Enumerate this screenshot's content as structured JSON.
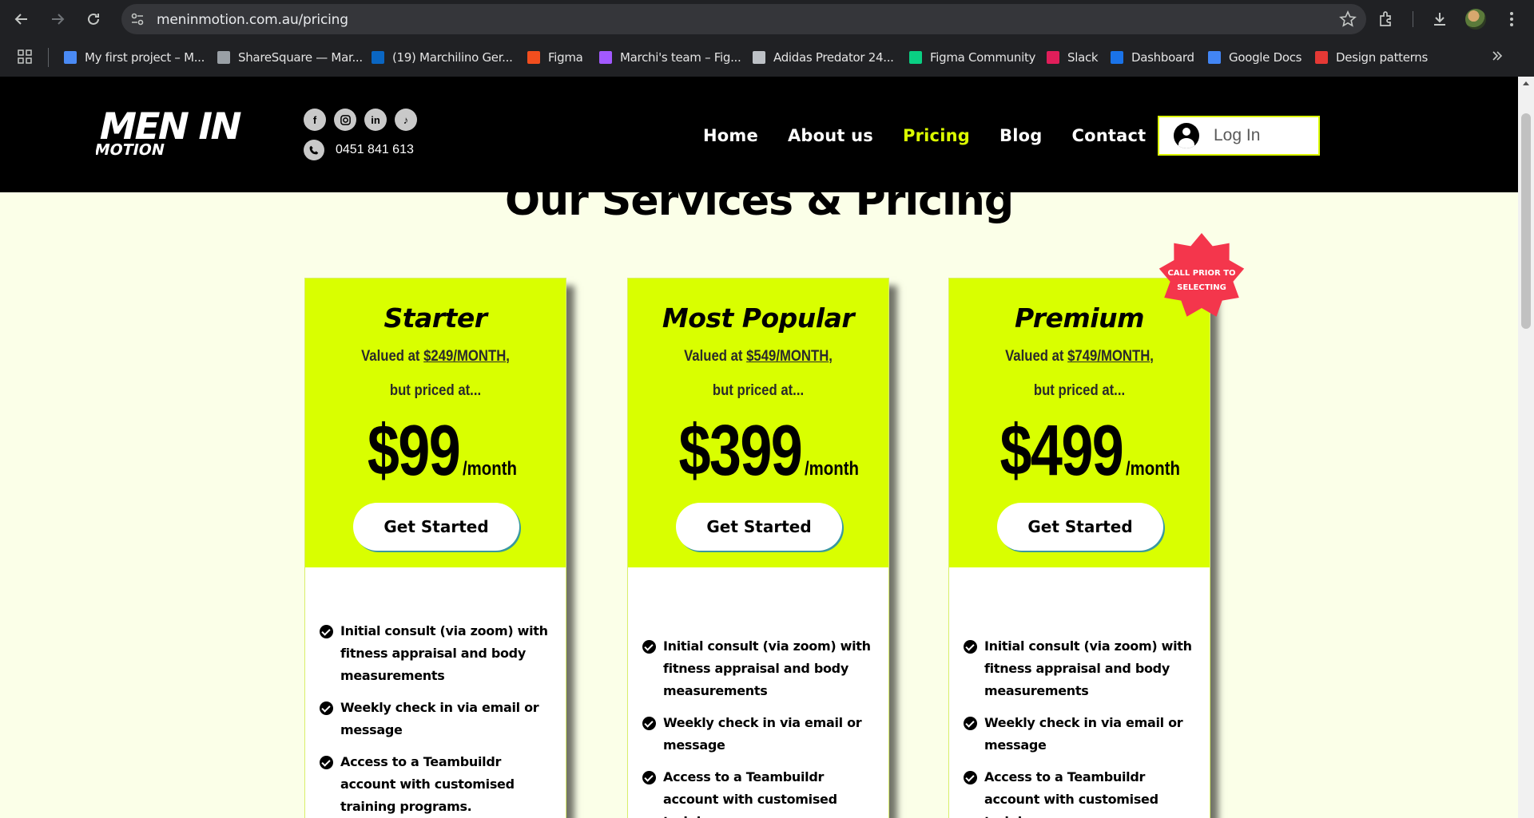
{
  "browser": {
    "url": "meninmotion.com.au/pricing",
    "bookmarks": [
      {
        "label": "My first project – M...",
        "color": "#4a8af4"
      },
      {
        "label": "ShareSquare — Mar...",
        "color": "#9aa0a6"
      },
      {
        "label": "(19) Marchilino Ger...",
        "color": "#0a66c2"
      },
      {
        "label": "Figma",
        "color": "#f24e1e"
      },
      {
        "label": "Marchi's team – Fig...",
        "color": "#a259ff"
      },
      {
        "label": "Adidas Predator 24...",
        "color": "#bdc1c6"
      },
      {
        "label": "Figma Community",
        "color": "#0acf83"
      },
      {
        "label": "Slack",
        "color": "#e01e5a"
      },
      {
        "label": "Dashboard",
        "color": "#1a73e8"
      },
      {
        "label": "Google Docs",
        "color": "#4285f4"
      },
      {
        "label": "Design patterns",
        "color": "#e53935"
      }
    ]
  },
  "header": {
    "logo_line1": "MEN IN",
    "logo_line2": "MOTION",
    "phone": "0451 841 613",
    "nav": [
      {
        "label": "Home",
        "active": false
      },
      {
        "label": "About us",
        "active": false
      },
      {
        "label": "Pricing",
        "active": true
      },
      {
        "label": "Blog",
        "active": false
      },
      {
        "label": "Contact",
        "active": false
      }
    ],
    "login_label": "Log In",
    "accent_color": "#dcff00"
  },
  "main": {
    "title": "Our Services & Pricing",
    "badge": {
      "line1": "CALL PRIOR TO",
      "line2": "SELECTING",
      "color": "#f4364c"
    },
    "plans": [
      {
        "name": "Starter",
        "valued_prefix": "Valued at ",
        "valued_amount": "$249/MONTH",
        "valued_suffix": ",",
        "priced_at": "but priced at...",
        "price": "$99",
        "period": "/month",
        "cta": "Get Started",
        "features": [
          "Initial consult (via zoom) with fitness appraisal and body measurements",
          "Weekly check in via email or message",
          "Access to a Teambuildr account with customised training programs."
        ]
      },
      {
        "name": "Most Popular",
        "valued_prefix": "Valued at ",
        "valued_amount": "$549/MONTH",
        "valued_suffix": ",",
        "priced_at": "but priced at...",
        "price": "$399",
        "period": "/month",
        "cta": "Get Started",
        "features": [
          "Initial consult (via zoom) with fitness appraisal and body measurements",
          "Weekly check in via email or message",
          "Access to a Teambuildr account with customised training"
        ]
      },
      {
        "name": "Premium",
        "valued_prefix": "Valued at ",
        "valued_amount": "$749/MONTH",
        "valued_suffix": ",",
        "priced_at": "but priced at...",
        "price": "$499",
        "period": "/month",
        "cta": "Get Started",
        "features": [
          "Initial consult (via zoom) with fitness appraisal and body measurements",
          "Weekly check in via email or message",
          "Access to a Teambuildr account with customised training"
        ]
      }
    ]
  }
}
